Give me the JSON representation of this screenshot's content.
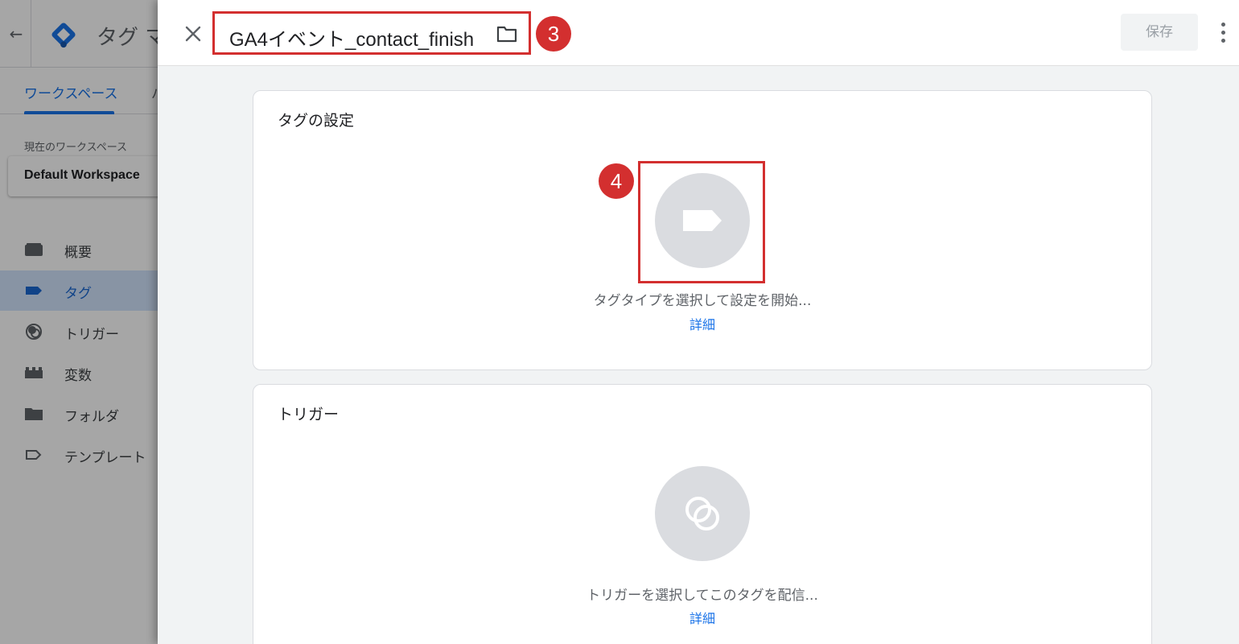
{
  "background_app": {
    "app_title": "タグ マ",
    "tabs": {
      "active": "ワークスペース",
      "other": "バ"
    },
    "workspace_label": "現在のワークスペース",
    "workspace_name": "Default Workspace",
    "nav_items": [
      {
        "label": "概要",
        "icon": "overview-icon",
        "active": false
      },
      {
        "label": "タグ",
        "icon": "tag-icon",
        "active": true
      },
      {
        "label": "トリガー",
        "icon": "trigger-icon",
        "active": false
      },
      {
        "label": "変数",
        "icon": "variables-icon",
        "active": false
      },
      {
        "label": "フォルダ",
        "icon": "folder-icon",
        "active": false
      },
      {
        "label": "テンプレート",
        "icon": "template-icon",
        "active": false
      }
    ]
  },
  "panel": {
    "tag_name": "GA4イベント_contact_finish",
    "save_label": "保存",
    "step3": "3",
    "step4": "4",
    "tag_config": {
      "title": "タグの設定",
      "placeholder": "タグタイプを選択して設定を開始...",
      "detail_link": "詳細"
    },
    "trigger": {
      "title": "トリガー",
      "placeholder": "トリガーを選択してこのタグを配信...",
      "detail_link": "詳細"
    }
  },
  "colors": {
    "accent": "#1a73e8",
    "annotation_red": "#d32f2f",
    "icon_circle": "#dadce0"
  }
}
